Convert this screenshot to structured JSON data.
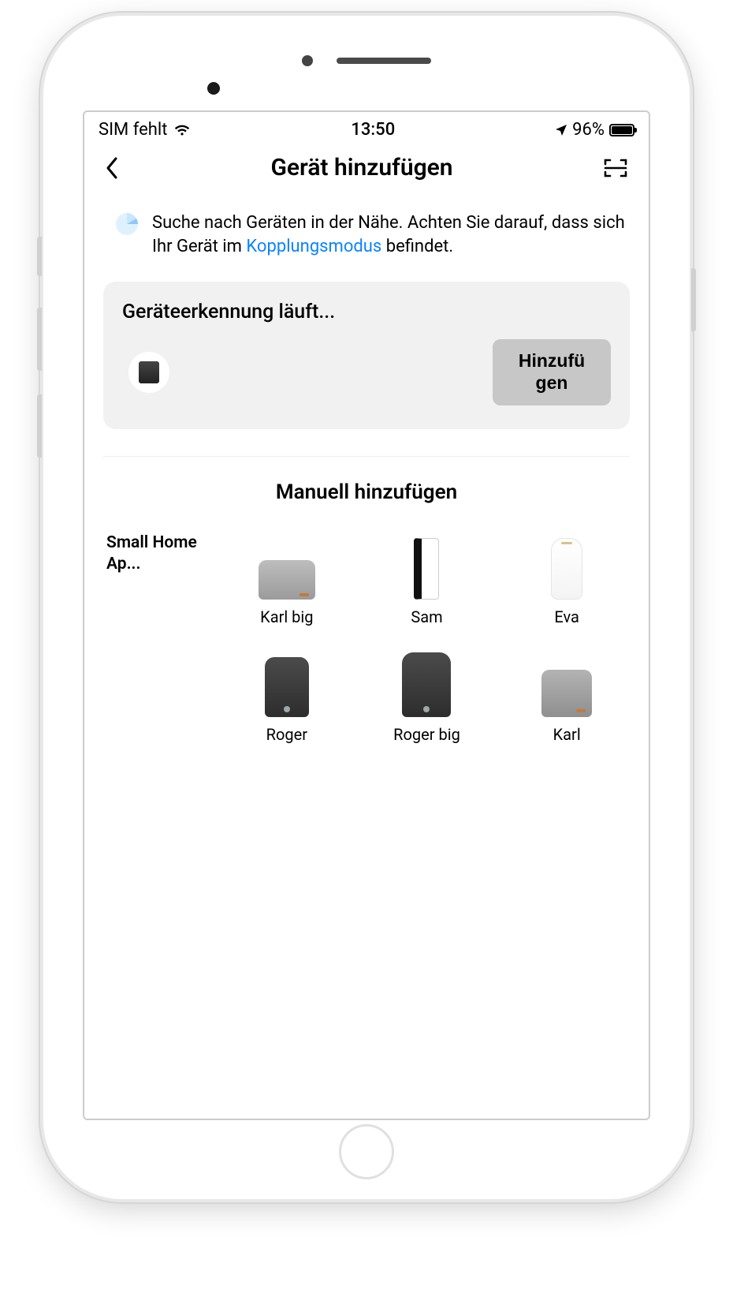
{
  "status": {
    "carrier": "SIM fehlt",
    "time": "13:50",
    "battery": "96%"
  },
  "header": {
    "title": "Gerät hinzufügen"
  },
  "info": {
    "text_before": "Suche nach Geräten in der Nähe. Achten Sie darauf, dass sich Ihr Gerät im ",
    "link": "Kopplungsmodus",
    "text_after": " befindet."
  },
  "detection": {
    "title": "Geräteerkennung läuft...",
    "add_button": "Hinzufü\ngen"
  },
  "manual": {
    "title": "Manuell hinzufügen",
    "category": "Small Home Ap...",
    "devices": [
      {
        "name": "Karl big",
        "shape": "dev-karlbig"
      },
      {
        "name": "Sam",
        "shape": "dev-sam"
      },
      {
        "name": "Eva",
        "shape": "dev-eva"
      },
      {
        "name": "Roger",
        "shape": "dev-roger"
      },
      {
        "name": "Roger big",
        "shape": "dev-rogerbig"
      },
      {
        "name": "Karl",
        "shape": "dev-karl"
      }
    ]
  }
}
